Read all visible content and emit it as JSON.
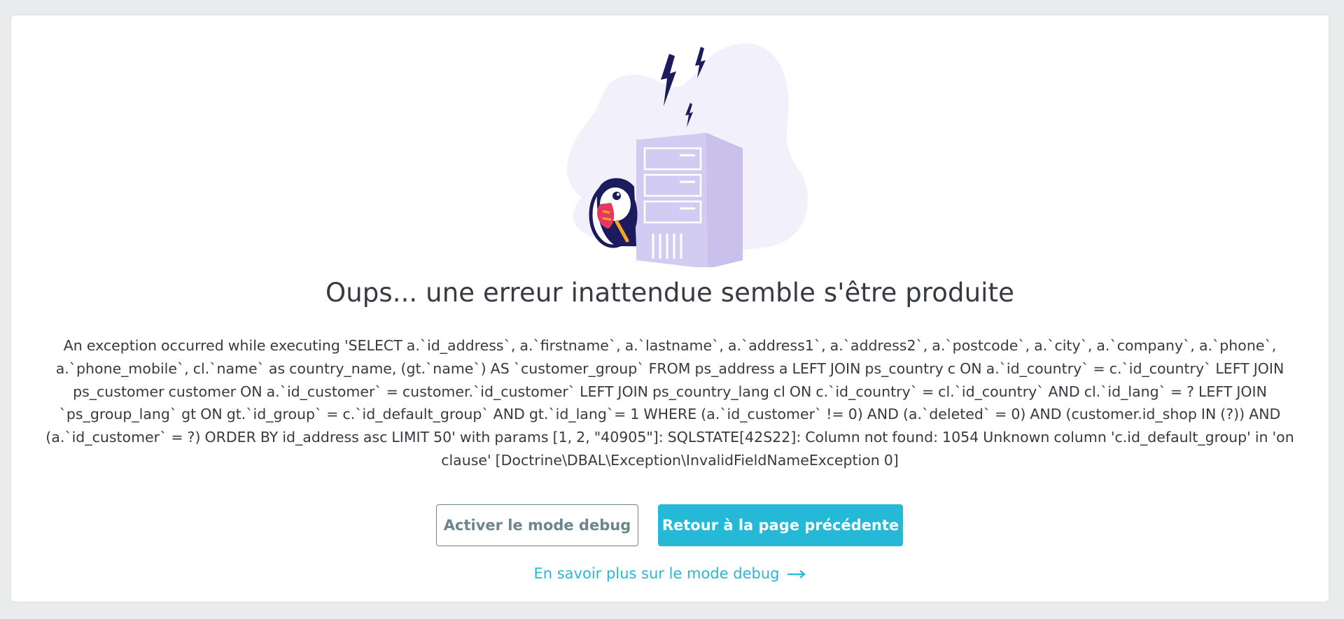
{
  "error": {
    "title": "Oups... une erreur inattendue semble s'être produite",
    "message": "An exception occurred while executing 'SELECT a.`id_address`, a.`firstname`, a.`lastname`, a.`address1`, a.`address2`, a.`postcode`, a.`city`, a.`company`, a.`phone`, a.`phone_mobile`, cl.`name` as country_name, (gt.`name`) AS `customer_group` FROM ps_address a LEFT JOIN ps_country c ON a.`id_country` = c.`id_country` LEFT JOIN ps_customer customer ON a.`id_customer` = customer.`id_customer` LEFT JOIN ps_country_lang cl ON c.`id_country` = cl.`id_country` AND cl.`id_lang` = ? LEFT JOIN `ps_group_lang` gt ON gt.`id_group` = c.`id_default_group` AND gt.`id_lang`= 1 WHERE (a.`id_customer` != 0) AND (a.`deleted` = 0) AND (customer.id_shop IN (?)) AND (a.`id_customer` = ?) ORDER BY id_address asc LIMIT 50' with params [1, 2, \"40905\"]: SQLSTATE[42S22]: Column not found: 1054 Unknown column 'c.id_default_group' in 'on clause' [Doctrine\\DBAL\\Exception\\InvalidFieldNameException 0]"
  },
  "actions": {
    "debug_label": "Activer le mode debug",
    "back_label": "Retour à la page précédente",
    "learn_more_label": "En savoir plus sur le mode debug"
  },
  "icons": {
    "illustration": "puffin-server-error-illustration",
    "link_arrow": "arrow-right-icon"
  },
  "colors": {
    "primary": "#25b9d7",
    "outline": "#6c868e",
    "text": "#363a41",
    "background": "#eaebec"
  }
}
